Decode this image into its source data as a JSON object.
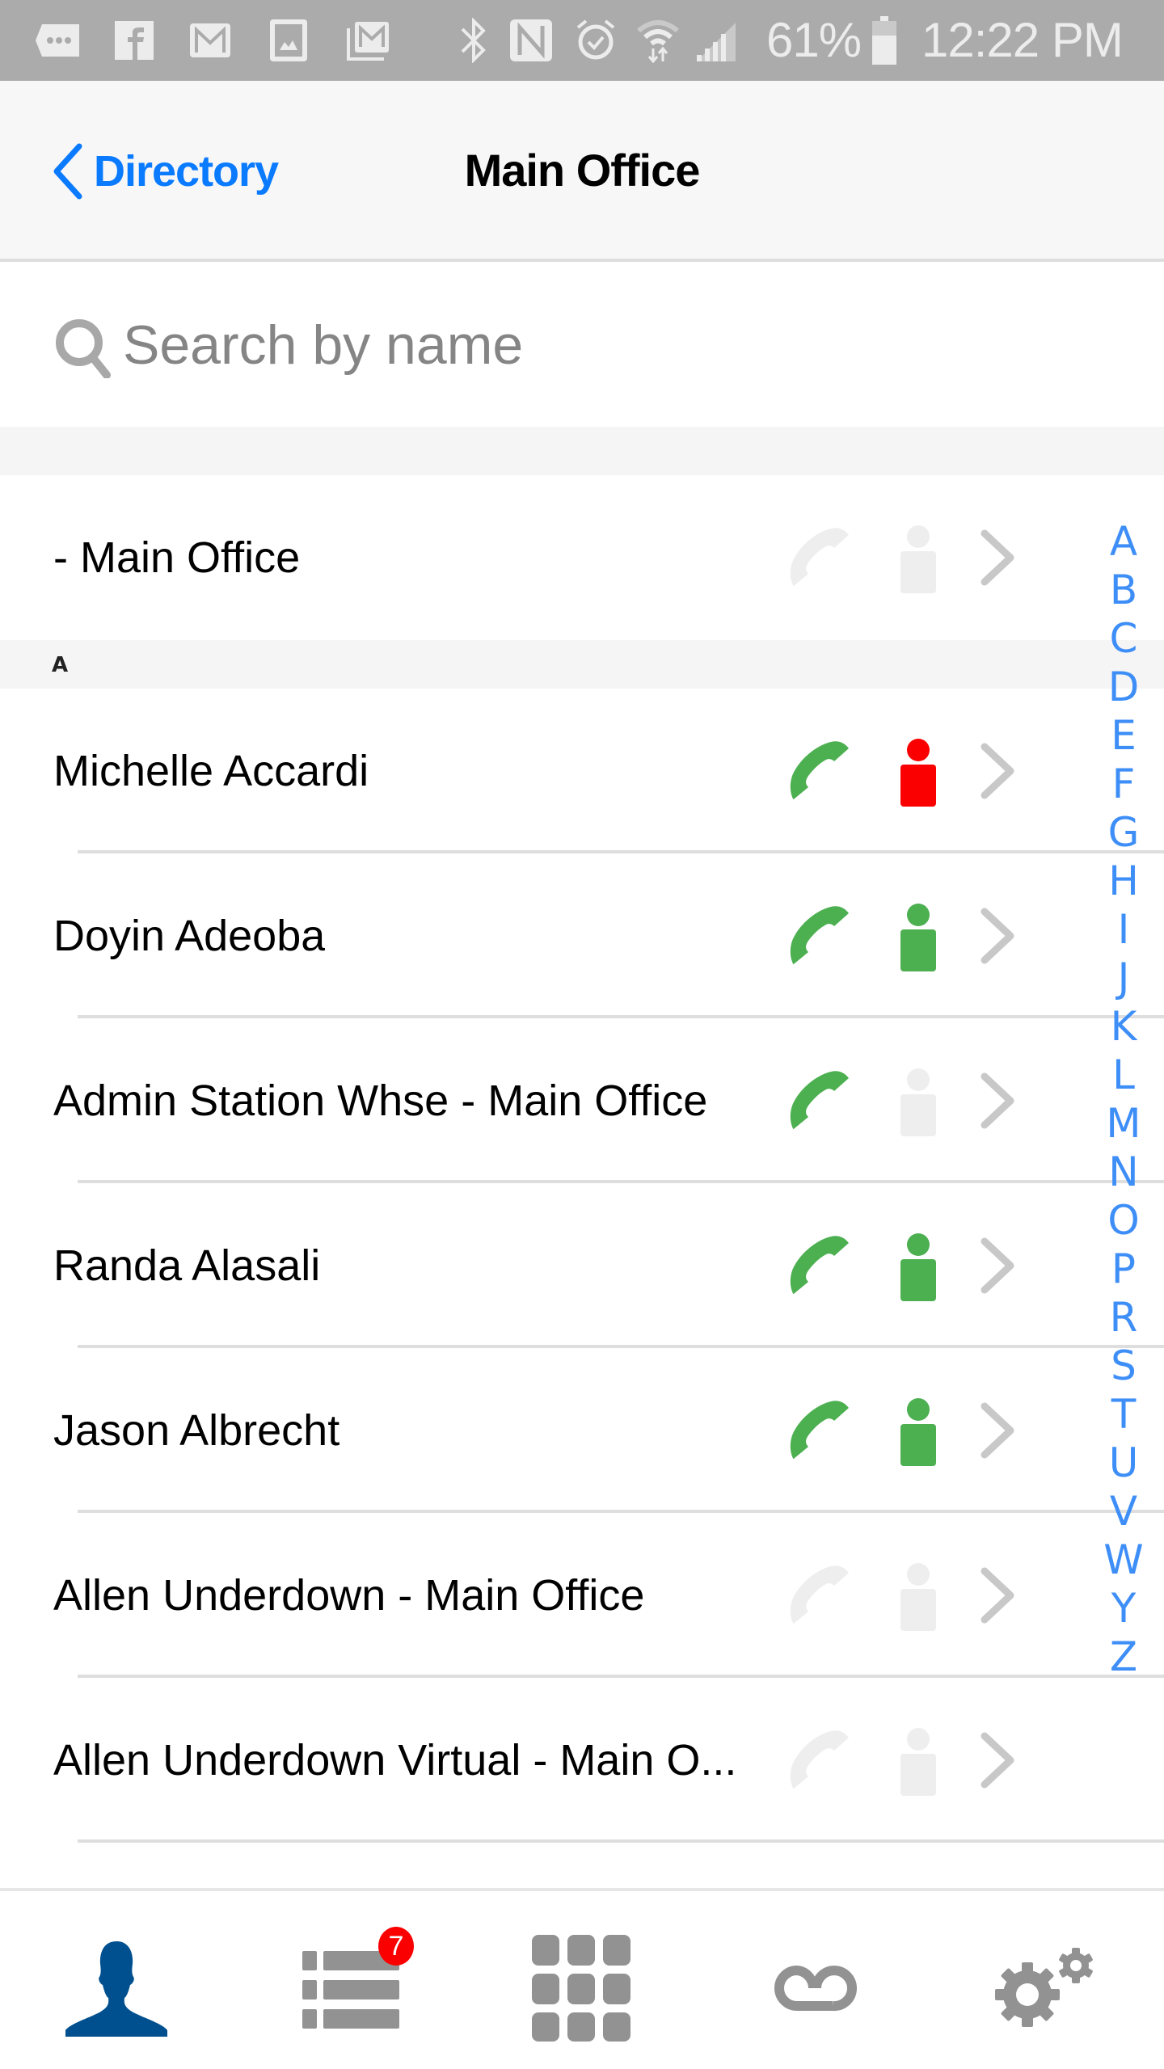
{
  "status_bar": {
    "notification_icons": [
      "messages-icon",
      "facebook-icon",
      "gmail-icon",
      "gallery-icon",
      "gmail-stack-icon"
    ],
    "system_icons": [
      "bluetooth-icon",
      "nfc-icon",
      "alarm-icon",
      "wifi-icon",
      "signal-icon"
    ],
    "battery": "61%",
    "time": "12:22 PM"
  },
  "header": {
    "back_label": "Directory",
    "title": "Main Office"
  },
  "search": {
    "placeholder": "Search by name",
    "value": ""
  },
  "colors": {
    "accent": "#0a7aff",
    "available": "#4caf50",
    "busy": "#fa0000",
    "inactive": "#eeeeee",
    "tab_active": "#00508f",
    "tab_inactive": "#929292",
    "index": "#3e8ef7"
  },
  "list": {
    "top_entry": {
      "name": "- Main Office",
      "phone": "inactive",
      "presence": "inactive"
    },
    "sections": [
      {
        "letter": "A",
        "contacts": [
          {
            "name": "Michelle Accardi",
            "phone": "available",
            "presence": "busy"
          },
          {
            "name": "Doyin Adeoba",
            "phone": "available",
            "presence": "available"
          },
          {
            "name": "Admin Station Whse - Main Office",
            "phone": "available",
            "presence": "inactive"
          },
          {
            "name": "Randa Alasali",
            "phone": "available",
            "presence": "available"
          },
          {
            "name": "Jason Albrecht",
            "phone": "available",
            "presence": "available"
          },
          {
            "name": "Allen Underdown - Main Office",
            "phone": "inactive",
            "presence": "inactive"
          },
          {
            "name": "Allen Underdown Virtual - Main O...",
            "phone": "inactive",
            "presence": "inactive"
          }
        ]
      }
    ]
  },
  "alpha_index": [
    "A",
    "B",
    "C",
    "D",
    "E",
    "F",
    "G",
    "H",
    "I",
    "J",
    "K",
    "L",
    "M",
    "N",
    "O",
    "P",
    "R",
    "S",
    "T",
    "U",
    "V",
    "W",
    "Y",
    "Z"
  ],
  "tabbar": {
    "tabs": [
      {
        "id": "contacts",
        "icon": "contacts-icon",
        "active": true
      },
      {
        "id": "recents",
        "icon": "recents-list-icon",
        "active": false,
        "badge": "7"
      },
      {
        "id": "keypad",
        "icon": "keypad-icon",
        "active": false
      },
      {
        "id": "voicemail",
        "icon": "voicemail-icon",
        "active": false
      },
      {
        "id": "settings",
        "icon": "settings-gears-icon",
        "active": false
      }
    ]
  }
}
